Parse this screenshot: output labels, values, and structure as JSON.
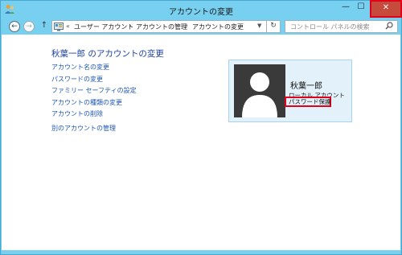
{
  "window": {
    "title": "アカウントの変更",
    "controls": {
      "minimize": "—",
      "maximize": "☐",
      "close": "✕"
    }
  },
  "navigation": {
    "back": "←",
    "forward": "→",
    "up": "↑",
    "chevron": "«",
    "breadcrumbs": [
      "ユーザー アカウント",
      "アカウントの管理",
      "アカウントの変更"
    ],
    "separator": "›",
    "dropdown": "▼",
    "refresh": "↻"
  },
  "search": {
    "placeholder": "コントロール パネルの検索",
    "icon": "search-icon"
  },
  "main": {
    "heading": "秋葉一郎 のアカウントの変更",
    "links": [
      "アカウント名の変更",
      "パスワードの変更",
      "ファミリー セーフティの設定",
      "アカウントの種類の変更",
      "アカウントの削除",
      "別のアカウントの管理"
    ]
  },
  "account": {
    "name": "秋葉一郎",
    "type": "ローカル アカウント",
    "status": "パスワード保護"
  },
  "colors": {
    "titlebar": "#78d0f0",
    "link": "#1c56b5",
    "heading": "#1a3f9e",
    "highlight": "#e0001a",
    "card_bg": "#e3f1fa"
  }
}
